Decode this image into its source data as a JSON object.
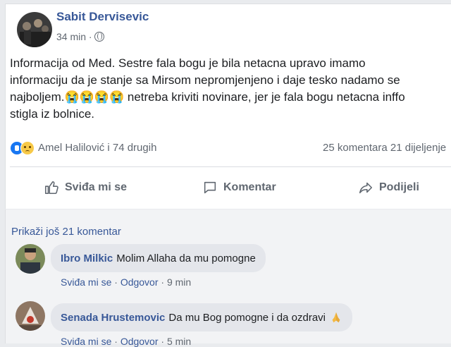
{
  "post": {
    "author": "Sabit Dervisevic",
    "time": "34 min",
    "separator": "·",
    "text": "Informacija od Med. Sestre fala bogu je bila netacna upravo imamo\ninformaciju da je stanje sa Mirsom nepromjenjeno i daje tesko nadamo se\nnajboljem.😭😭😭😭 netreba kriviti novinare, jer je fala bogu netacna inffo\nstigla iz bolnice.",
    "reactions_text": "Amel Halilović i 74 drugih",
    "comments_shares": "25 komentara  21 dijeljenje"
  },
  "actions": {
    "like": "Sviđa mi se",
    "comment": "Komentar",
    "share": "Podijeli"
  },
  "comments": {
    "view_more": "Prikaži još 21 komentar",
    "items": [
      {
        "name": "Ibro Milkic",
        "text": "Molim Allaha da mu pomogne",
        "like": "Sviđa mi se",
        "reply": "Odgovor",
        "time": "9 min"
      },
      {
        "name": "Senada Hrustemovic",
        "text": "Da mu Bog pomogne i da ozdravi",
        "like": "Sviđa mi se",
        "reply": "Odgovor",
        "time": "5 min"
      }
    ]
  },
  "icons": [
    "globe-icon",
    "like-reaction-icon",
    "cry-reaction-icon",
    "thumbs-up-icon",
    "comment-icon",
    "share-icon",
    "praying-hands-icon"
  ],
  "colors": {
    "link": "#385898",
    "meta": "#606770",
    "like_blue": "#1877f2",
    "bubble": "#e4e6eb"
  }
}
